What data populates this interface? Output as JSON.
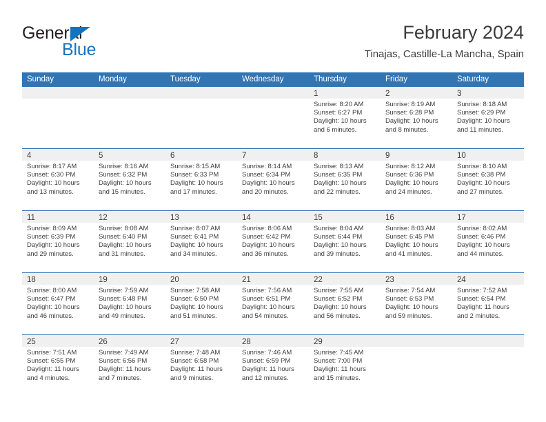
{
  "logo": {
    "word_one": "General",
    "word_two": "Blue",
    "triangle_color": "#1573bd"
  },
  "header": {
    "title": "February 2024",
    "subtitle": "Tinajas, Castille-La Mancha, Spain"
  },
  "theme": {
    "header_blue": "#3175b4",
    "day_band_gray": "#f0f0f0",
    "text_color": "#3c3c3c"
  },
  "weekdays": [
    "Sunday",
    "Monday",
    "Tuesday",
    "Wednesday",
    "Thursday",
    "Friday",
    "Saturday"
  ],
  "weeks": [
    [
      {
        "empty": true
      },
      {
        "empty": true
      },
      {
        "empty": true
      },
      {
        "empty": true
      },
      {
        "day": "1",
        "sunrise": "Sunrise: 8:20 AM",
        "sunset": "Sunset: 6:27 PM",
        "daylight": "Daylight: 10 hours and 6 minutes."
      },
      {
        "day": "2",
        "sunrise": "Sunrise: 8:19 AM",
        "sunset": "Sunset: 6:28 PM",
        "daylight": "Daylight: 10 hours and 8 minutes."
      },
      {
        "day": "3",
        "sunrise": "Sunrise: 8:18 AM",
        "sunset": "Sunset: 6:29 PM",
        "daylight": "Daylight: 10 hours and 11 minutes."
      }
    ],
    [
      {
        "day": "4",
        "sunrise": "Sunrise: 8:17 AM",
        "sunset": "Sunset: 6:30 PM",
        "daylight": "Daylight: 10 hours and 13 minutes."
      },
      {
        "day": "5",
        "sunrise": "Sunrise: 8:16 AM",
        "sunset": "Sunset: 6:32 PM",
        "daylight": "Daylight: 10 hours and 15 minutes."
      },
      {
        "day": "6",
        "sunrise": "Sunrise: 8:15 AM",
        "sunset": "Sunset: 6:33 PM",
        "daylight": "Daylight: 10 hours and 17 minutes."
      },
      {
        "day": "7",
        "sunrise": "Sunrise: 8:14 AM",
        "sunset": "Sunset: 6:34 PM",
        "daylight": "Daylight: 10 hours and 20 minutes."
      },
      {
        "day": "8",
        "sunrise": "Sunrise: 8:13 AM",
        "sunset": "Sunset: 6:35 PM",
        "daylight": "Daylight: 10 hours and 22 minutes."
      },
      {
        "day": "9",
        "sunrise": "Sunrise: 8:12 AM",
        "sunset": "Sunset: 6:36 PM",
        "daylight": "Daylight: 10 hours and 24 minutes."
      },
      {
        "day": "10",
        "sunrise": "Sunrise: 8:10 AM",
        "sunset": "Sunset: 6:38 PM",
        "daylight": "Daylight: 10 hours and 27 minutes."
      }
    ],
    [
      {
        "day": "11",
        "sunrise": "Sunrise: 8:09 AM",
        "sunset": "Sunset: 6:39 PM",
        "daylight": "Daylight: 10 hours and 29 minutes."
      },
      {
        "day": "12",
        "sunrise": "Sunrise: 8:08 AM",
        "sunset": "Sunset: 6:40 PM",
        "daylight": "Daylight: 10 hours and 31 minutes."
      },
      {
        "day": "13",
        "sunrise": "Sunrise: 8:07 AM",
        "sunset": "Sunset: 6:41 PM",
        "daylight": "Daylight: 10 hours and 34 minutes."
      },
      {
        "day": "14",
        "sunrise": "Sunrise: 8:06 AM",
        "sunset": "Sunset: 6:42 PM",
        "daylight": "Daylight: 10 hours and 36 minutes."
      },
      {
        "day": "15",
        "sunrise": "Sunrise: 8:04 AM",
        "sunset": "Sunset: 6:44 PM",
        "daylight": "Daylight: 10 hours and 39 minutes."
      },
      {
        "day": "16",
        "sunrise": "Sunrise: 8:03 AM",
        "sunset": "Sunset: 6:45 PM",
        "daylight": "Daylight: 10 hours and 41 minutes."
      },
      {
        "day": "17",
        "sunrise": "Sunrise: 8:02 AM",
        "sunset": "Sunset: 6:46 PM",
        "daylight": "Daylight: 10 hours and 44 minutes."
      }
    ],
    [
      {
        "day": "18",
        "sunrise": "Sunrise: 8:00 AM",
        "sunset": "Sunset: 6:47 PM",
        "daylight": "Daylight: 10 hours and 46 minutes."
      },
      {
        "day": "19",
        "sunrise": "Sunrise: 7:59 AM",
        "sunset": "Sunset: 6:48 PM",
        "daylight": "Daylight: 10 hours and 49 minutes."
      },
      {
        "day": "20",
        "sunrise": "Sunrise: 7:58 AM",
        "sunset": "Sunset: 6:50 PM",
        "daylight": "Daylight: 10 hours and 51 minutes."
      },
      {
        "day": "21",
        "sunrise": "Sunrise: 7:56 AM",
        "sunset": "Sunset: 6:51 PM",
        "daylight": "Daylight: 10 hours and 54 minutes."
      },
      {
        "day": "22",
        "sunrise": "Sunrise: 7:55 AM",
        "sunset": "Sunset: 6:52 PM",
        "daylight": "Daylight: 10 hours and 56 minutes."
      },
      {
        "day": "23",
        "sunrise": "Sunrise: 7:54 AM",
        "sunset": "Sunset: 6:53 PM",
        "daylight": "Daylight: 10 hours and 59 minutes."
      },
      {
        "day": "24",
        "sunrise": "Sunrise: 7:52 AM",
        "sunset": "Sunset: 6:54 PM",
        "daylight": "Daylight: 11 hours and 2 minutes."
      }
    ],
    [
      {
        "day": "25",
        "sunrise": "Sunrise: 7:51 AM",
        "sunset": "Sunset: 6:55 PM",
        "daylight": "Daylight: 11 hours and 4 minutes."
      },
      {
        "day": "26",
        "sunrise": "Sunrise: 7:49 AM",
        "sunset": "Sunset: 6:56 PM",
        "daylight": "Daylight: 11 hours and 7 minutes."
      },
      {
        "day": "27",
        "sunrise": "Sunrise: 7:48 AM",
        "sunset": "Sunset: 6:58 PM",
        "daylight": "Daylight: 11 hours and 9 minutes."
      },
      {
        "day": "28",
        "sunrise": "Sunrise: 7:46 AM",
        "sunset": "Sunset: 6:59 PM",
        "daylight": "Daylight: 11 hours and 12 minutes."
      },
      {
        "day": "29",
        "sunrise": "Sunrise: 7:45 AM",
        "sunset": "Sunset: 7:00 PM",
        "daylight": "Daylight: 11 hours and 15 minutes."
      },
      {
        "empty": true
      },
      {
        "empty": true
      }
    ]
  ]
}
